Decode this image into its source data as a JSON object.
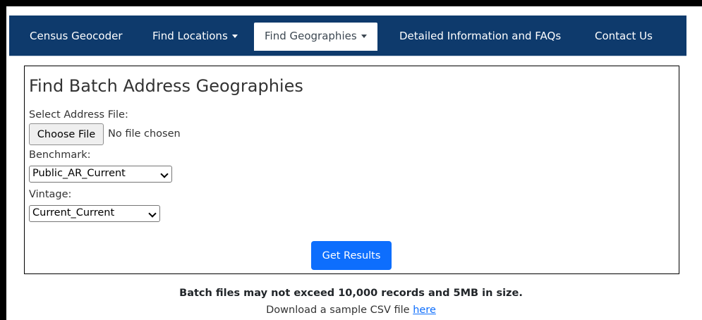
{
  "nav": {
    "items": [
      {
        "label": "Census Geocoder"
      },
      {
        "label": "Find Locations"
      },
      {
        "label": "Find Geographies"
      },
      {
        "label": "Detailed Information and FAQs"
      },
      {
        "label": "Contact Us"
      }
    ],
    "active_index": 2
  },
  "form": {
    "title": "Find Batch Address Geographies",
    "file_label": "Select Address File:",
    "file_button": "Choose File",
    "file_status": "No file chosen",
    "benchmark_label": "Benchmark:",
    "benchmark_value": "Public_AR_Current",
    "vintage_label": "Vintage:",
    "vintage_value": "Current_Current",
    "submit_label": "Get Results"
  },
  "footer": {
    "notice": "Batch files may not exceed 10,000 records and 5MB in size.",
    "download_text": "Download a sample CSV file",
    "download_link": "here"
  },
  "colors": {
    "navbar": "#0e3a6c",
    "primary_button": "#0d6efd",
    "link": "#0d6efd"
  }
}
